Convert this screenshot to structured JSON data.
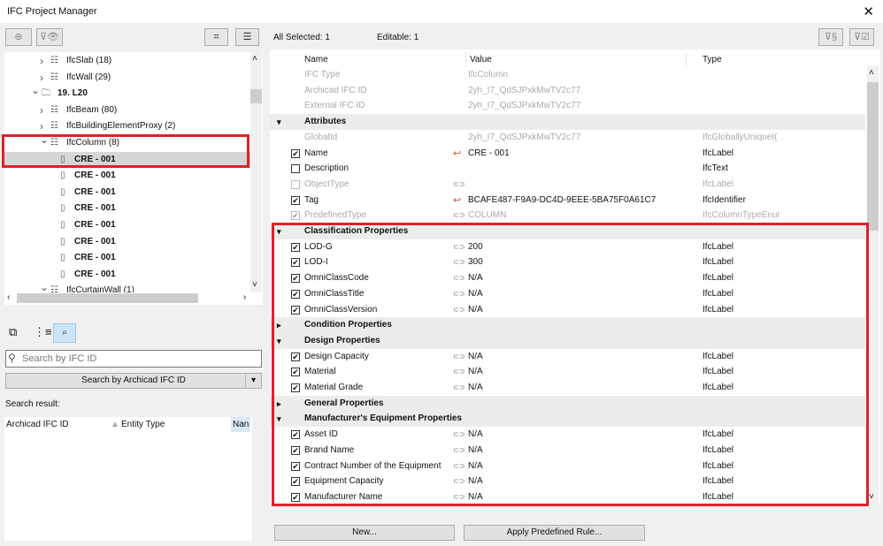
{
  "window": {
    "title": "IFC Project Manager",
    "close": "✕"
  },
  "left": {
    "tree": [
      {
        "label": "IfcSlab (18)",
        "level": 2,
        "arrow": ">",
        "icon": "tree-list-icon"
      },
      {
        "label": "IfcWall (29)",
        "level": 2,
        "arrow": ">",
        "icon": "tree-list-icon"
      },
      {
        "label": "19. L20",
        "level": 1,
        "arrow": "v",
        "icon": "folder-icon",
        "bold": true
      },
      {
        "label": "IfcBeam (80)",
        "level": 2,
        "arrow": ">",
        "icon": "tree-list-icon"
      },
      {
        "label": "IfcBuildingElementProxy (2)",
        "level": 2,
        "arrow": ">",
        "icon": "tree-list-icon"
      },
      {
        "label": "IfcColumn (8)",
        "level": 2,
        "arrow": "v",
        "icon": "tree-list-icon"
      },
      {
        "label": "CRE - 001",
        "level": 3,
        "icon": "column-icon",
        "bold": true,
        "selected": true
      },
      {
        "label": "CRE - 001",
        "level": 3,
        "icon": "column-icon",
        "bold": true
      },
      {
        "label": "CRE - 001",
        "level": 3,
        "icon": "column-icon",
        "bold": true
      },
      {
        "label": "CRE - 001",
        "level": 3,
        "icon": "column-icon",
        "bold": true
      },
      {
        "label": "CRE - 001",
        "level": 3,
        "icon": "column-icon",
        "bold": true
      },
      {
        "label": "CRE - 001",
        "level": 3,
        "icon": "column-icon",
        "bold": true
      },
      {
        "label": "CRE - 001",
        "level": 3,
        "icon": "column-icon",
        "bold": true
      },
      {
        "label": "CRE - 001",
        "level": 3,
        "icon": "column-icon",
        "bold": true
      },
      {
        "label": "IfcCurtainWall (1)",
        "level": 2,
        "arrow": "v",
        "icon": "tree-list-icon"
      }
    ],
    "search_placeholder": "Search by IFC ID",
    "search_button": "Search by Archicad IFC ID",
    "search_result_label": "Search result:",
    "result_columns": [
      "Archicad IFC ID",
      "Entity Type",
      "Nan"
    ]
  },
  "right": {
    "all_selected": "All Selected: 1",
    "editable": "Editable: 1",
    "columns": [
      "Name",
      "Value",
      "Type"
    ],
    "rows": [
      {
        "name": "IFC Type",
        "value": "IfcColumn",
        "type": "",
        "dim": true
      },
      {
        "name": "Archicad IFC ID",
        "value": "2yh_I7_QdSJPxkMwTV2c77",
        "type": "",
        "dim": true
      },
      {
        "name": "External IFC ID",
        "value": "2yh_I7_QdSJPxkMwTV2c77",
        "type": "",
        "dim": true
      },
      {
        "name": "Attributes",
        "group": true,
        "expanded": true
      },
      {
        "name": "GlobalId",
        "value": "2yh_I7_QdSJPxkMwTV2c77",
        "type": "IfcGloballyUniqueI(",
        "dim": true
      },
      {
        "name": "Name",
        "value": "CRE - 001",
        "type": "IfcLabel",
        "check": "✔",
        "vicon": "override"
      },
      {
        "name": "Description",
        "value": "",
        "type": "IfcText",
        "check": " "
      },
      {
        "name": "ObjectType",
        "value": "",
        "type": "IfcLabel",
        "check": " ",
        "vicon": "link",
        "dim": true
      },
      {
        "name": "Tag",
        "value": "BCAFE487-F9A9-DC4D-9EEE-5BA75F0A61C7",
        "type": "IfcIdentifier",
        "check": "✔",
        "vicon": "override"
      },
      {
        "name": "PredefinedType",
        "value": "COLUMN",
        "type": "IfcColumnTypeEnur",
        "check": "✔",
        "vicon": "link",
        "dim": true
      },
      {
        "name": "Classification Properties",
        "group": true,
        "expanded": true
      },
      {
        "name": "LOD-G",
        "value": "200",
        "type": "IfcLabel",
        "check": "✔",
        "vicon": "link"
      },
      {
        "name": "LOD-I",
        "value": "300",
        "type": "IfcLabel",
        "check": "✔",
        "vicon": "link"
      },
      {
        "name": "OmniClassCode",
        "value": "N/A",
        "type": "IfcLabel",
        "check": "✔",
        "vicon": "link"
      },
      {
        "name": "OmniClassTitle",
        "value": "N/A",
        "type": "IfcLabel",
        "check": "✔",
        "vicon": "link"
      },
      {
        "name": "OmniClassVersion",
        "value": "N/A",
        "type": "IfcLabel",
        "check": "✔",
        "vicon": "link"
      },
      {
        "name": "Condition Properties",
        "group": true,
        "expanded": false
      },
      {
        "name": "Design Properties",
        "group": true,
        "expanded": true
      },
      {
        "name": "Design Capacity",
        "value": "N/A",
        "type": "IfcLabel",
        "check": "✔",
        "vicon": "link"
      },
      {
        "name": "Material",
        "value": "N/A",
        "type": "IfcLabel",
        "check": "✔",
        "vicon": "link"
      },
      {
        "name": "Material Grade",
        "value": "N/A",
        "type": "IfcLabel",
        "check": "✔",
        "vicon": "link"
      },
      {
        "name": "General Properties",
        "group": true,
        "expanded": false
      },
      {
        "name": "Manufacturer's Equipment Properties",
        "group": true,
        "expanded": true
      },
      {
        "name": "Asset ID",
        "value": "N/A",
        "type": "IfcLabel",
        "check": "✔",
        "vicon": "link"
      },
      {
        "name": "Brand Name",
        "value": "N/A",
        "type": "IfcLabel",
        "check": "✔",
        "vicon": "link"
      },
      {
        "name": "Contract Number of the Equipment",
        "value": "N/A",
        "type": "IfcLabel",
        "check": "✔",
        "vicon": "link"
      },
      {
        "name": "Equipment Capacity",
        "value": "N/A",
        "type": "IfcLabel",
        "check": "✔",
        "vicon": "link"
      },
      {
        "name": "Manufacturer Name",
        "value": "N/A",
        "type": "IfcLabel",
        "check": "✔",
        "vicon": "link"
      }
    ],
    "new_button": "New...",
    "apply_button": "Apply Predefined Rule...",
    "highlight_color": "#e0202a"
  }
}
